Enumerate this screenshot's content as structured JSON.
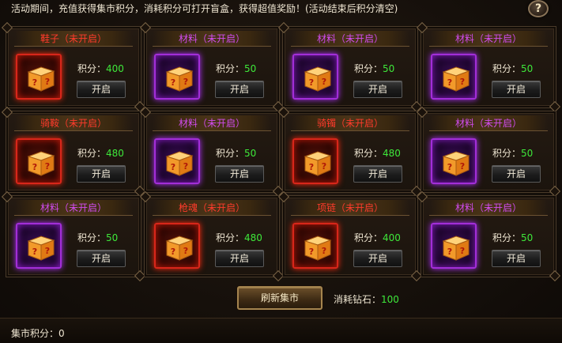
{
  "notice": "活动期间，充值获得集市积分，消耗积分可打开盲盒，获得超值奖励！(活动结束后积分清空)",
  "help_label": "?",
  "score_prefix": "积分：",
  "open_label": "开启",
  "colors": {
    "red_title": "#ff3b2b",
    "purple_title": "#d24cf0",
    "score_green": "#3ee83a"
  },
  "cards": [
    {
      "title": "鞋子（未开启）",
      "rarity": "red",
      "score": "400"
    },
    {
      "title": "材料（未开启）",
      "rarity": "purple",
      "score": "50"
    },
    {
      "title": "材料（未开启）",
      "rarity": "purple",
      "score": "50"
    },
    {
      "title": "材料（未开启）",
      "rarity": "purple",
      "score": "50"
    },
    {
      "title": "骑鞍（未开启）",
      "rarity": "red",
      "score": "480"
    },
    {
      "title": "材料（未开启）",
      "rarity": "purple",
      "score": "50"
    },
    {
      "title": "骑镯（未开启）",
      "rarity": "red",
      "score": "480"
    },
    {
      "title": "材料（未开启）",
      "rarity": "purple",
      "score": "50"
    },
    {
      "title": "材料（未开启）",
      "rarity": "purple",
      "score": "50"
    },
    {
      "title": "枪魂（未开启）",
      "rarity": "red",
      "score": "480"
    },
    {
      "title": "项链（未开启）",
      "rarity": "red",
      "score": "400"
    },
    {
      "title": "材料（未开启）",
      "rarity": "purple",
      "score": "50"
    }
  ],
  "refresh_label": "刷新集市",
  "cost": {
    "label": "消耗钻石：",
    "value": "100"
  },
  "market_score": {
    "label": "集市积分：",
    "value": "0"
  },
  "icons": {
    "box": "mystery-box-icon",
    "help": "help-icon"
  }
}
